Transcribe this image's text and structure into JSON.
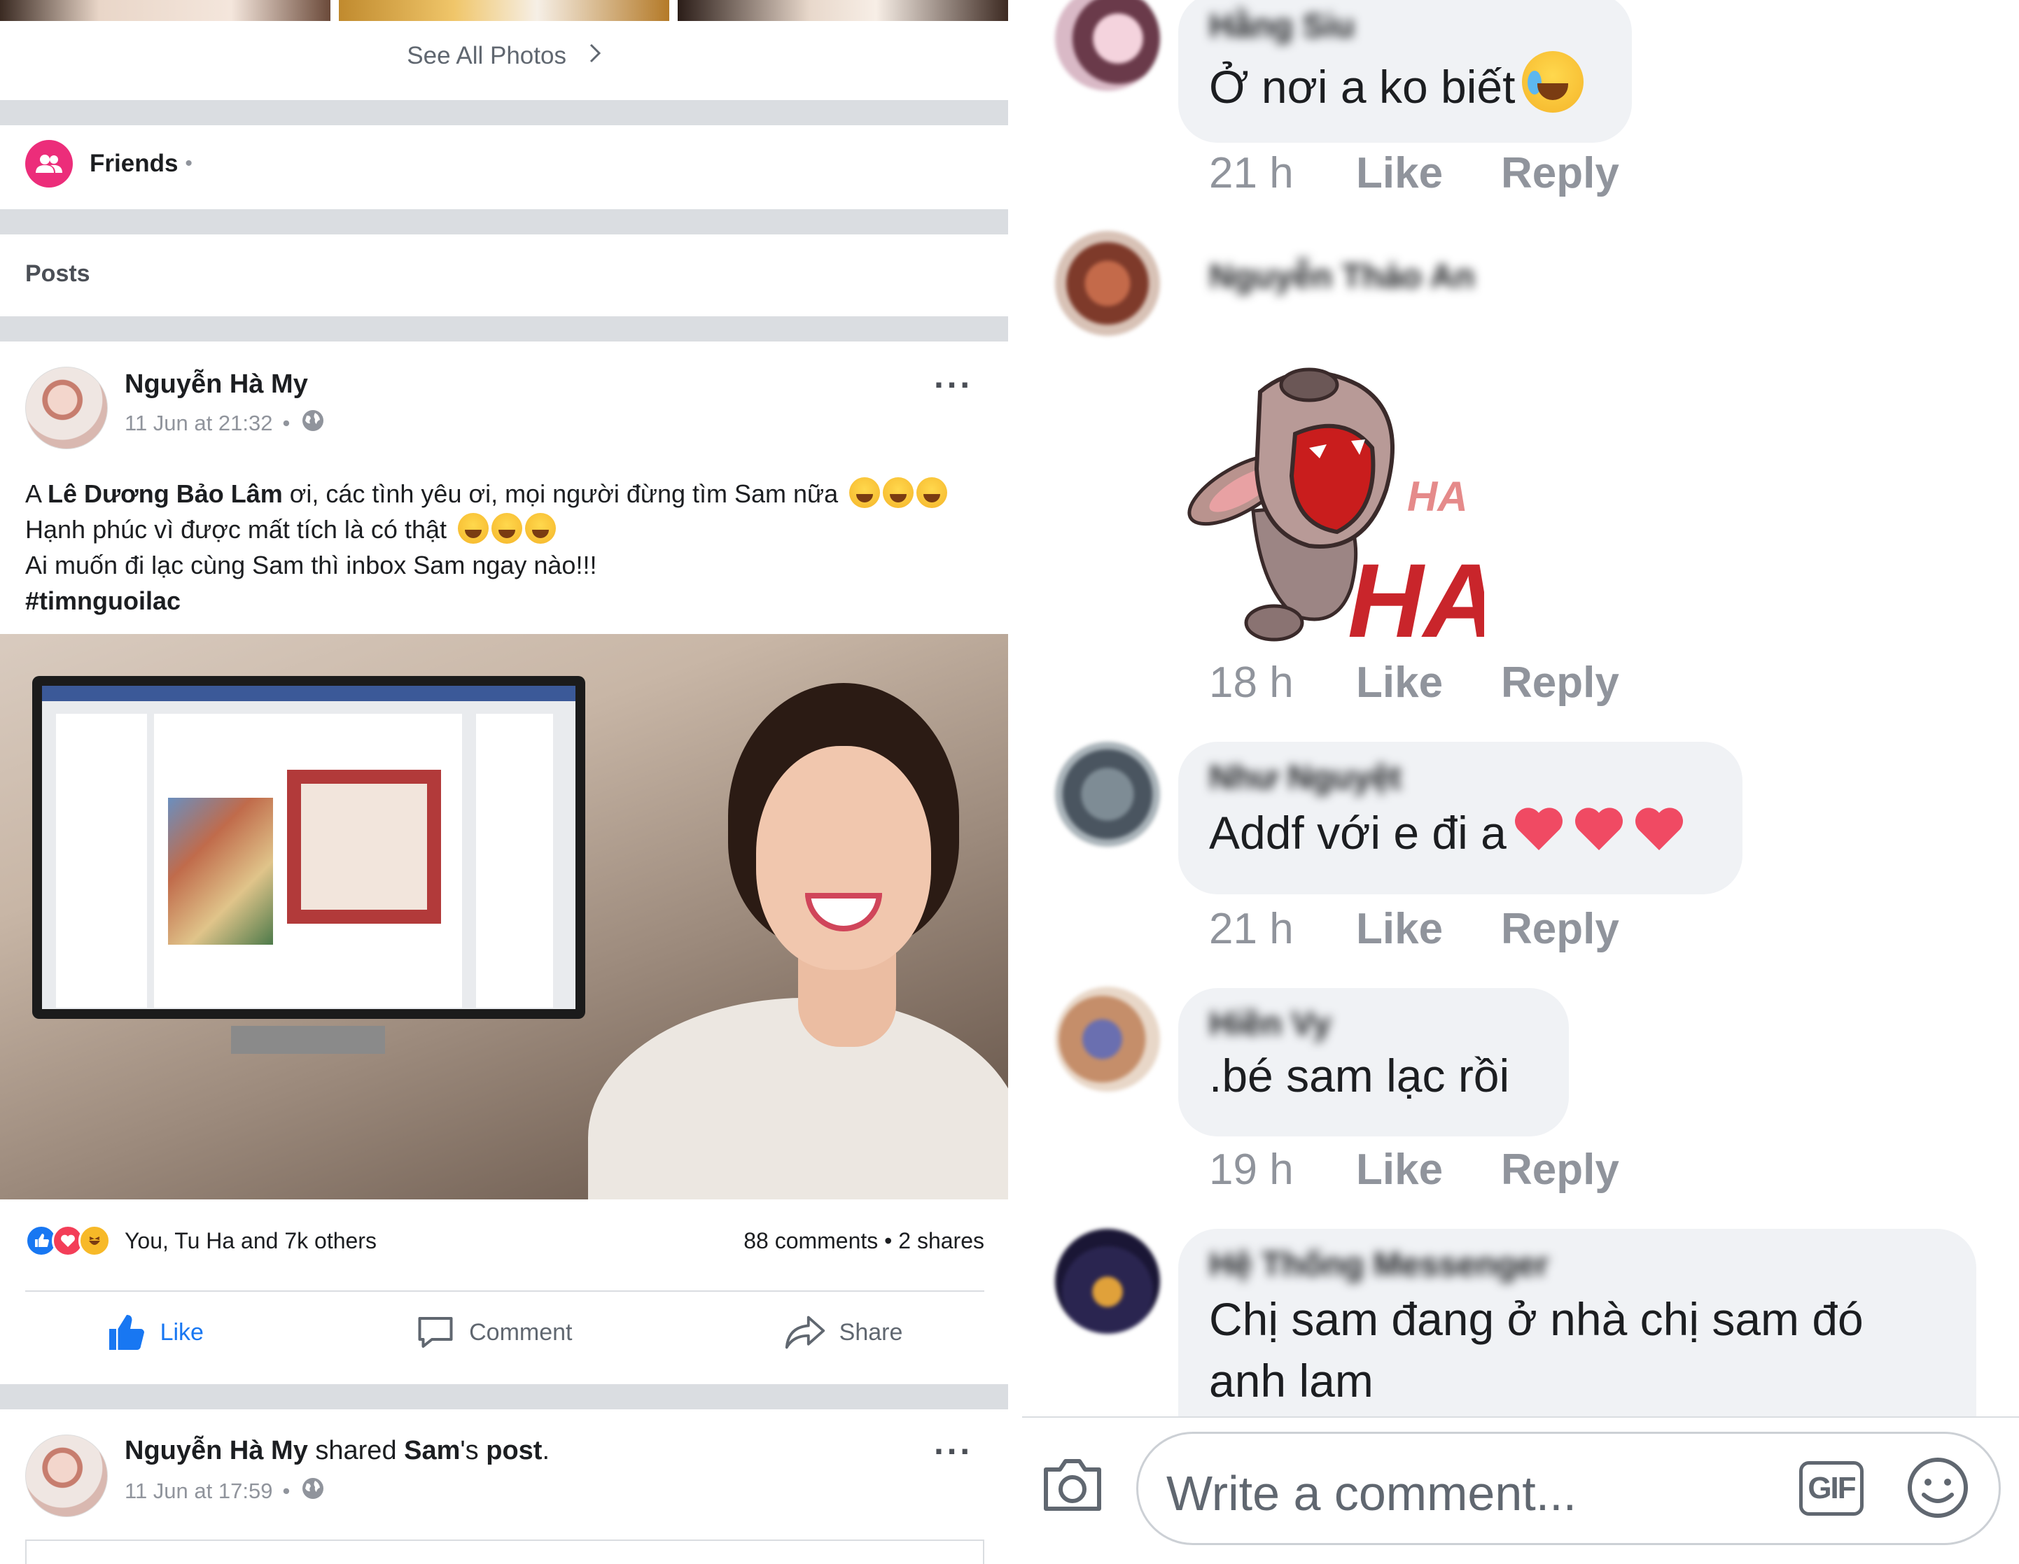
{
  "photos": {
    "see_all_label": "See All Photos"
  },
  "friends": {
    "label": "Friends"
  },
  "posts": {
    "section_label": "Posts"
  },
  "post1": {
    "author": "Nguyễn Hà My",
    "time": "11 Jun at 21:32",
    "line1_prefix": "A ",
    "line1_mention": "Lê Dương Bảo Lâm",
    "line1_rest": " ơi, các tình yêu ơi, mọi người đừng tìm Sam nữa",
    "line2": "Hạnh phúc vì được mất tích là có thật",
    "line3": "Ai muốn đi lạc cùng Sam thì inbox Sam ngay nào!!!",
    "hashtag": "#timnguoilac",
    "reactions_text": "You, Tu Ha and 7k others",
    "counts_text": "88 comments • 2 shares",
    "actions": {
      "like": "Like",
      "comment": "Comment",
      "share": "Share"
    }
  },
  "post2": {
    "author": "Nguyễn Hà My",
    "shared_word": " shared ",
    "shared_owner": "Sam",
    "shared_suffix": "'s ",
    "shared_object": "post",
    "dot": ".",
    "time": "11 Jun at 17:59"
  },
  "comments": [
    {
      "name": "Hằng Siu",
      "text": "Ở nơi a ko biết",
      "time": "21 h",
      "like": "Like",
      "reply": "Reply"
    },
    {
      "name": "Nguyễn Thảo An",
      "sticker": "HA HA",
      "time": "18 h",
      "like": "Like",
      "reply": "Reply"
    },
    {
      "name": "Như Nguyệt",
      "text": "Addf với e đi a",
      "time": "21 h",
      "like": "Like",
      "reply": "Reply"
    },
    {
      "name": "Hiền Vy",
      "text": ".bé sam lạc rồi",
      "time": "19 h",
      "like": "Like",
      "reply": "Reply"
    },
    {
      "name": "Hệ Thống Messenger",
      "text": "Chị sam đang ở nhà chị sam đó anh lam"
    }
  ],
  "composer": {
    "placeholder": "Write a comment...",
    "gif_label": "GIF"
  },
  "colors": {
    "facebook_blue": "#1877f2",
    "friends_pink": "#ec2d7a",
    "bubble_gray": "#f0f2f5",
    "meta_gray": "#90949c"
  }
}
